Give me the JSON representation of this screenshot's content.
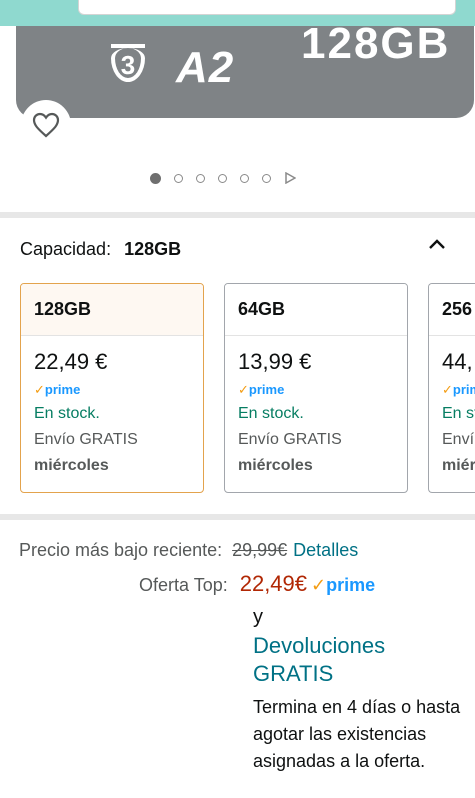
{
  "product_image": {
    "card_class": "3",
    "card_app_class": "A2",
    "card_capacity": "128GB",
    "carousel_dots": 6,
    "carousel_active_index": 0
  },
  "capacity": {
    "label": "Capacidad:",
    "selected_value": "128GB"
  },
  "options": [
    {
      "size": "128GB",
      "price": "22,49 €",
      "prime": "prime",
      "stock": "En stock.",
      "shipping": "Envío GRATIS",
      "delivery": "miércoles"
    },
    {
      "size": "64GB",
      "price": "13,99 €",
      "prime": "prime",
      "stock": "En stock.",
      "shipping": "Envío GRATIS",
      "delivery": "miércoles"
    },
    {
      "size": "256",
      "price": "44,",
      "prime": "prim",
      "stock": "En st",
      "shipping": "Enví",
      "delivery": "miér"
    }
  ],
  "pricing": {
    "recent_low_label": "Precio más bajo reciente:",
    "recent_low_price": "29,99€",
    "details_link": "Detalles",
    "top_offer_label": "Oferta Top:",
    "top_offer_price": "22,49€",
    "prime_label": "prime",
    "and_text": "y",
    "returns_text": "Devoluciones GRATIS",
    "ends_text": "Termina en 4 días o hasta agotar las existencias asignadas a la oferta."
  },
  "colors": {
    "accent_orange": "#e3a34d",
    "prime_blue": "#1a98ff",
    "stock_green": "#067d62",
    "deal_red": "#b12704",
    "link_teal": "#007185"
  },
  "icons": [
    "heart-icon",
    "chevron-up-icon",
    "play-icon",
    "prime-check-icon"
  ]
}
